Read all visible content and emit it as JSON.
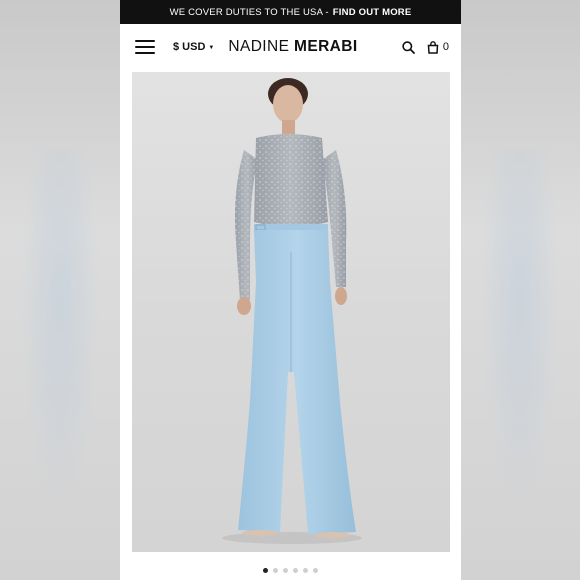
{
  "promo": {
    "text": "WE COVER DUTIES TO THE USA -",
    "link": "FIND OUT MORE"
  },
  "header": {
    "menu_icon": "hamburger-icon",
    "currency": "$ USD",
    "logo_light": "NADINE ",
    "logo_bold": "MERABI",
    "search_icon": "search-icon",
    "bag_icon": "shopping-bag-icon",
    "cart_count": "0"
  },
  "gallery": {
    "image_alt": "Model wearing embellished sheer long-sleeve bodysuit and light blue flared trousers",
    "slide_count": 6,
    "active_slide": 1
  },
  "colors": {
    "promo_bg": "#111111",
    "trouser_blue": "#a9cde6",
    "top_silver": "#a6acb3"
  }
}
